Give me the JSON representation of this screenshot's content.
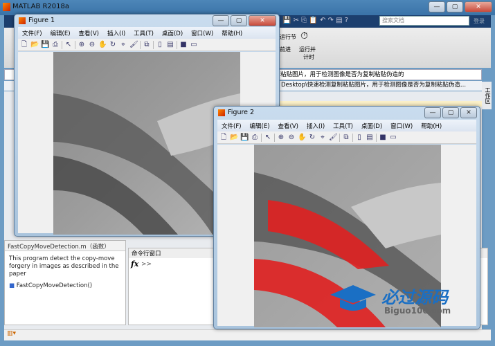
{
  "main": {
    "title": "MATLAB R2018a",
    "search_placeholder": "搜索文档",
    "login": "登录",
    "toolstrip": {
      "run_section": "运行节",
      "advance": "前进",
      "run_time_1": "运行并",
      "run_time_2": "计时"
    },
    "address": "粘贴图片，用于检测图像是否为复制粘贴伪造的",
    "path": "Desktop\\快速检测复制粘贴图片，用于检测图像是否为复制粘贴伪造...",
    "workspace_tab": "工作区"
  },
  "menu": [
    "文件(F)",
    "编辑(E)",
    "查看(V)",
    "插入(I)",
    "工具(T)",
    "桌面(D)",
    "窗口(W)",
    "帮助(H)"
  ],
  "figure1": {
    "title": "Figure 1"
  },
  "figure2": {
    "title": "Figure 2"
  },
  "details": {
    "header": "FastCopyMoveDetection.m（函数）",
    "description": "This program detect the copy-move forgery in images as described in the paper",
    "function": "FastCopyMoveDetection()"
  },
  "command": {
    "header": "命令行窗口",
    "fx": "fx",
    "prompt": ">>"
  },
  "watermark": {
    "cn": "必过源码",
    "url": "Biguo100.com"
  },
  "colors": {
    "titlebar": "#3a73a8",
    "highlight": "#e02020"
  }
}
